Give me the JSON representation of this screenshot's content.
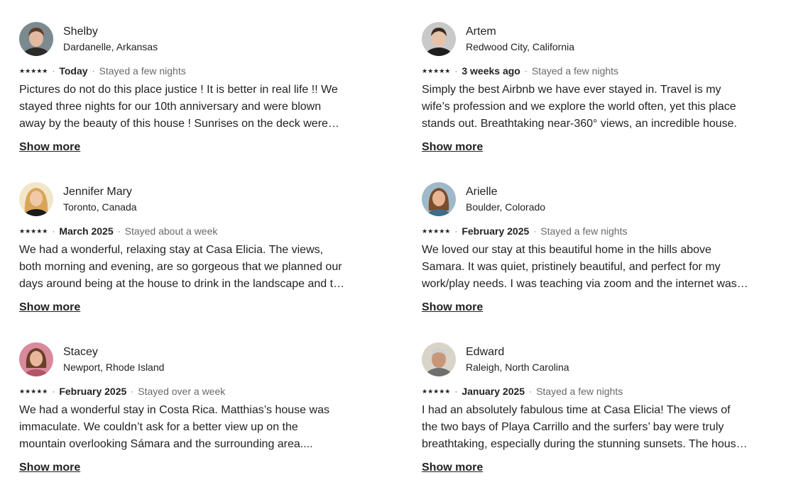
{
  "reviews": [
    {
      "name": "Shelby",
      "location": "Dardanelle, Arkansas",
      "rating_stars": "★★★★★",
      "when": "Today",
      "stay": "Stayed a few nights",
      "text": "Pictures do not do this place justice ! It is better in real life !! We stayed three nights for our 10th anniversary and were blown away by the beauty of this house ! Sunrises on the deck were magical.",
      "show_more": "Show more",
      "avatar_colors": {
        "bg": "#7b8a8f",
        "face": "#e2b9a1",
        "hair": "#5a3e2b",
        "shirt": "#2b2b2b"
      }
    },
    {
      "name": "Artem",
      "location": "Redwood City, California",
      "rating_stars": "★★★★★",
      "when": "3 weeks ago",
      "stay": "Stayed a few nights",
      "text": "Simply the best Airbnb we have ever stayed in. Travel is my wife’s profession and we explore the world often, yet this place stands out. Breathtaking near-360° views, an incredible house.",
      "show_more": "Show more",
      "avatar_colors": {
        "bg": "#c9c9c9",
        "face": "#e6c2a8",
        "hair": "#3b2a20",
        "shirt": "#1e1e1e"
      }
    },
    {
      "name": "Jennifer Mary",
      "location": "Toronto, Canada",
      "rating_stars": "★★★★★",
      "when": "March 2025",
      "stay": "Stayed about a week",
      "text": "We had a wonderful, relaxing stay at Casa Elicia. The views, both morning and evening, are so gorgeous that we planned our days around being at the house to drink in the landscape and the sunsets.",
      "show_more": "Show more",
      "avatar_colors": {
        "bg": "#f2e6c9",
        "face": "#f0c9a8",
        "hair": "#d8a55a",
        "shirt": "#1a1a1a"
      }
    },
    {
      "name": "Arielle",
      "location": "Boulder, Colorado",
      "rating_stars": "★★★★★",
      "when": "February 2025",
      "stay": "Stayed a few nights",
      "text": "We loved our stay at this beautiful home in the hills above Samara. It was quiet, pristinely beautiful, and perfect for my work/play needs. I was teaching via zoom and the internet was great.",
      "show_more": "Show more",
      "avatar_colors": {
        "bg": "#9fb9c9",
        "face": "#e7b594",
        "hair": "#7a4e2e",
        "shirt": "#3f6d8a"
      }
    },
    {
      "name": "Stacey",
      "location": "Newport, Rhode Island",
      "rating_stars": "★★★★★",
      "when": "February 2025",
      "stay": "Stayed over a week",
      "text": "We had a wonderful stay in Costa Rica. Matthias’s house was immaculate.  We couldn’t ask for a better view up on the mountain overlooking Sámara and the surrounding area....",
      "show_more": "Show more",
      "avatar_colors": {
        "bg": "#d98a9c",
        "face": "#e9b89c",
        "hair": "#6b3f2a",
        "shirt": "#b25466"
      }
    },
    {
      "name": "Edward",
      "location": "Raleigh, North Carolina",
      "rating_stars": "★★★★★",
      "when": "January 2025",
      "stay": "Stayed a few nights",
      "text": "I had an absolutely fabulous time at Casa Elicia! The views of the two bays of Playa Carrillo and the surfers’ bay were truly breathtaking, especially during the stunning sunsets. The house was perfect.",
      "show_more": "Show more",
      "avatar_colors": {
        "bg": "#d9d4c8",
        "face": "#c8977a",
        "hair": "#cfcfcf",
        "shirt": "#6f6f6f"
      }
    }
  ]
}
